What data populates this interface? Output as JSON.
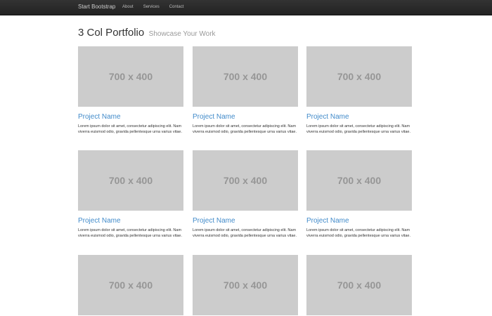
{
  "navbar": {
    "brand": "Start Bootstrap",
    "links": [
      "About",
      "Services",
      "Contact"
    ]
  },
  "header": {
    "title": "3 Col Portfolio",
    "subtitle": "Showcase Your Work"
  },
  "portfolio": {
    "items": [
      {
        "placeholder": "700 x 400",
        "name": "Project Name",
        "desc": "Lorem ipsum dolor sit amet, consectetur adipiscing elit. Nam viverra euismod odio, gravida pellentesque urna varius vitae."
      },
      {
        "placeholder": "700 x 400",
        "name": "Project Name",
        "desc": "Lorem ipsum dolor sit amet, consectetur adipiscing elit. Nam viverra euismod odio, gravida pellentesque urna varius vitae."
      },
      {
        "placeholder": "700 x 400",
        "name": "Project Name",
        "desc": "Lorem ipsum dolor sit amet, consectetur adipiscing elit. Nam viverra euismod odio, gravida pellentesque urna varius vitae."
      },
      {
        "placeholder": "700 x 400",
        "name": "Project Name",
        "desc": "Lorem ipsum dolor sit amet, consectetur adipiscing elit. Nam viverra euismod odio, gravida pellentesque urna varius vitae."
      },
      {
        "placeholder": "700 x 400",
        "name": "Project Name",
        "desc": "Lorem ipsum dolor sit amet, consectetur adipiscing elit. Nam viverra euismod odio, gravida pellentesque urna varius vitae."
      },
      {
        "placeholder": "700 x 400",
        "name": "Project Name",
        "desc": "Lorem ipsum dolor sit amet, consectetur adipiscing elit. Nam viverra euismod odio, gravida pellentesque urna varius vitae."
      },
      {
        "placeholder": "700 x 400"
      },
      {
        "placeholder": "700 x 400"
      },
      {
        "placeholder": "700 x 400"
      }
    ]
  }
}
